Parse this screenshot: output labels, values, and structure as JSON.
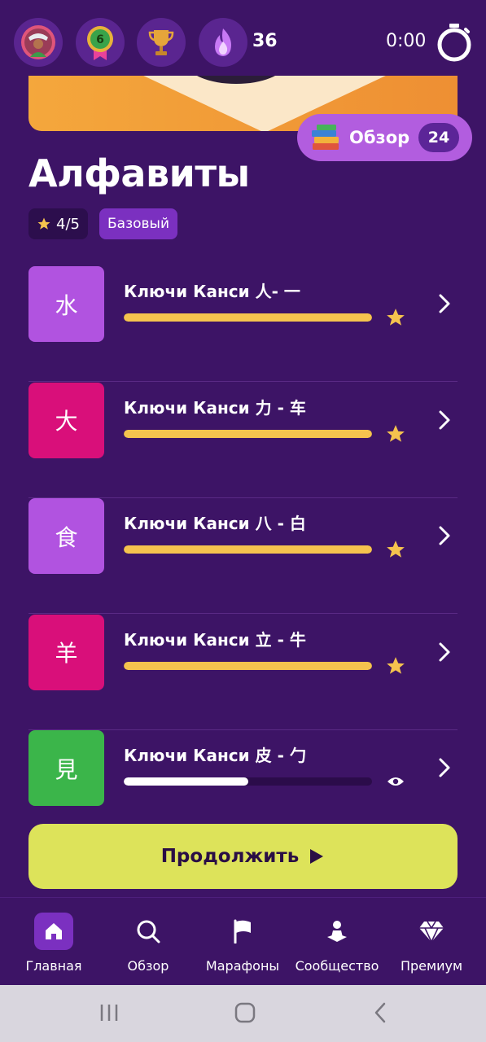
{
  "topbar": {
    "streak_count": "36",
    "timer": "0:00",
    "level_badge": "6",
    "icons": [
      "avatar",
      "level-badge-icon",
      "trophy-icon",
      "flame-icon",
      "stopwatch-icon"
    ]
  },
  "review": {
    "label": "Обзор",
    "count": "24",
    "icon": "books-icon"
  },
  "page": {
    "title": "Алфавиты",
    "rating": "4/5",
    "level": "Базовый"
  },
  "lessons": [
    {
      "char": "水",
      "title": "Ключи Канси 人- 一",
      "progress": 1.0,
      "status": "star",
      "tile_color": "#b153e0"
    },
    {
      "char": "大",
      "title": "Ключи Канси 力 - 车",
      "progress": 1.0,
      "status": "star",
      "tile_color": "#d90f7a"
    },
    {
      "char": "食",
      "title": "Ключи Канси 八 - 白",
      "progress": 1.0,
      "status": "star",
      "tile_color": "#b153e0"
    },
    {
      "char": "羊",
      "title": "Ключи Канси 立 - 牛",
      "progress": 1.0,
      "status": "star",
      "tile_color": "#d90f7a"
    },
    {
      "char": "見",
      "title": "Ключи Канси 皮 - 勹",
      "progress": 0.5,
      "status": "eye",
      "tile_color": "#3bb54a"
    }
  ],
  "continue_button": {
    "label": "Продолжить"
  },
  "nav": {
    "items": [
      {
        "label": "Главная",
        "icon": "home-icon",
        "active": true
      },
      {
        "label": "Обзор",
        "icon": "search-icon",
        "active": false
      },
      {
        "label": "Марафоны",
        "icon": "flag-icon",
        "active": false
      },
      {
        "label": "Сообщество",
        "icon": "community-icon",
        "active": false
      },
      {
        "label": "Премиум",
        "icon": "diamond-icon",
        "active": false
      }
    ]
  },
  "colors": {
    "background": "#3d1466",
    "progress_fill": "#f5c34e",
    "progress_partial": "#ffffff",
    "continue_bg": "#dde35a",
    "star": "#f5c34e"
  }
}
